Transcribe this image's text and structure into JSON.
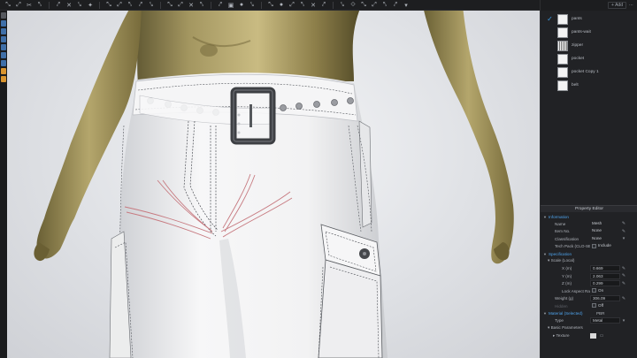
{
  "toolbar": {
    "icons": [
      "select-mesh-icon",
      "transform-icon",
      "pattern-icon",
      "sewing-icon",
      "arrange-icon",
      "pin-icon",
      "fold-icon",
      "measure-icon",
      "tape-icon",
      "avatar-icon",
      "texture-icon",
      "graphic-icon",
      "trim-icon",
      "button-icon",
      "zipper-icon",
      "topstitch-icon",
      "puckering-icon",
      "fabric-icon",
      "camera-icon",
      "sphere-icon",
      "layer-icon",
      "expand-icon"
    ]
  },
  "object_browser": {
    "add_label": "Add",
    "items": [
      {
        "label": "pants",
        "selected": true
      },
      {
        "label": "pants-wait",
        "selected": false
      },
      {
        "label": "zipper",
        "selected": false
      },
      {
        "label": "pocket",
        "selected": false
      },
      {
        "label": "pocket Copy 1",
        "selected": false
      },
      {
        "label": "belt",
        "selected": false
      }
    ]
  },
  "property_editor": {
    "title": "Property Editor",
    "information": {
      "label": "Information",
      "name_label": "Name",
      "name_value": "Mesh",
      "item_no_label": "Item No.",
      "item_no_value": "None",
      "classification_label": "Classification",
      "classification_value": "None",
      "tech_pack_label": "Tech Pack (CLO-SET)",
      "tech_pack_value": "Include"
    },
    "specification": {
      "label": "Specification",
      "scale_label": "Scale (Local)",
      "x_label": "X (m)",
      "x_value": "0.669",
      "y_label": "Y (m)",
      "y_value": "2.063",
      "z_label": "Z (m)",
      "z_value": "0.299",
      "lock_label": "Lock Aspect Ratio",
      "lock_value": "On",
      "weight_label": "Weight (g)",
      "weight_value": "306.09",
      "hidden_label": "Hidden",
      "hidden_value": "Off"
    },
    "material": {
      "label": "Material (Selected)",
      "label_value": "PBR",
      "type_label": "Type",
      "type_value": "Metal",
      "basic_label": "Basic Parameters",
      "texture_label": "Texture"
    }
  },
  "colors": {
    "accent": "#4ea3ec",
    "check": "#3a9be8",
    "panel_bg": "#212225",
    "mannequin": "#a89a62"
  }
}
